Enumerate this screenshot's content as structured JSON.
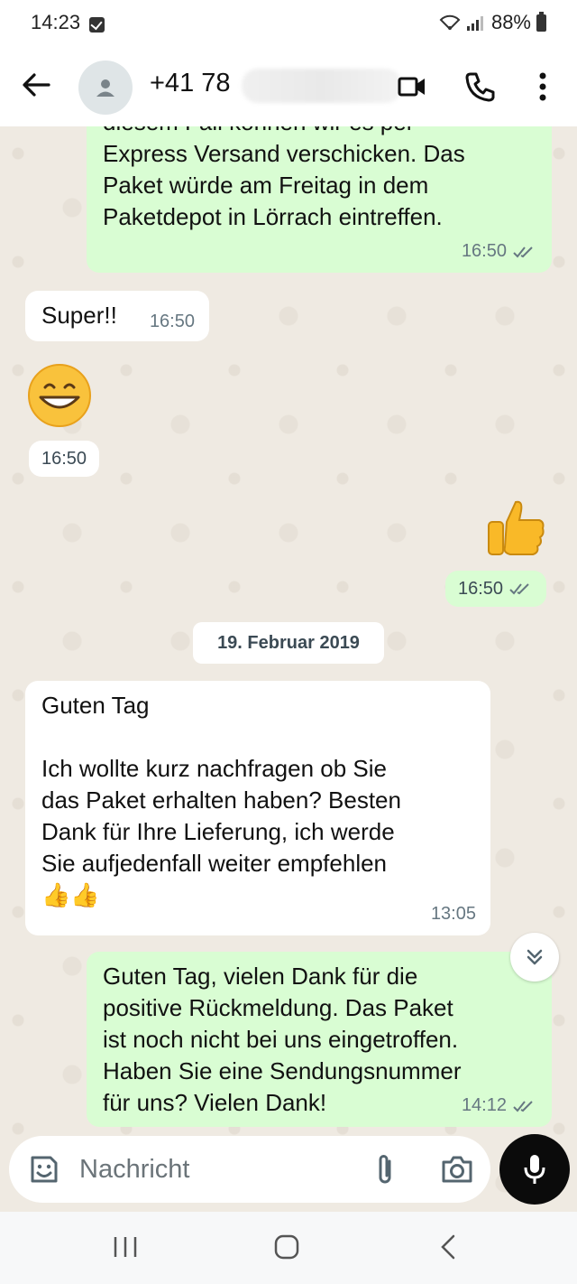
{
  "status_bar": {
    "time": "14:23",
    "battery": "88%"
  },
  "header": {
    "contact_name": "+41 78"
  },
  "messages": [
    {
      "direction": "out",
      "text_partial_top": "diesem Fall können wir es per",
      "text": "Express Versand verschicken. Das\nPaket würde am Freitag in dem\nPaketdepot in Lörrach eintreffen.",
      "time": "16:50"
    },
    {
      "direction": "in",
      "text": "Super!!",
      "time": "16:50"
    },
    {
      "direction": "in",
      "emoji": "😁",
      "time": "16:50"
    },
    {
      "direction": "out",
      "emoji": "👍",
      "time": "16:50"
    },
    {
      "direction": "in",
      "text": "Guten Tag\n\nIch wollte kurz nachfragen ob Sie\ndas Paket erhalten haben? Besten\nDank für Ihre Lieferung, ich werde\nSie aufjedenfall weiter empfehlen\n👍👍",
      "time": "13:05"
    },
    {
      "direction": "out",
      "text": "Guten Tag, vielen Dank für die\npositive Rückmeldung. Das Paket\nist noch nicht bei uns eingetroffen.\nHaben Sie eine Sendungsnummer\nfür uns? Vielen Dank!",
      "time": "14:12"
    }
  ],
  "date_divider": "19. Februar 2019",
  "input": {
    "placeholder": "Nachricht"
  },
  "colors": {
    "chat_bg": "#efeae2",
    "outgoing_bubble": "#d9fdd3",
    "incoming_bubble": "#ffffff",
    "read_tick": "#53bdeb",
    "mic_button": "#0b0b0b"
  },
  "icons": [
    "back-arrow-icon",
    "avatar-person-icon",
    "video-call-icon",
    "phone-call-icon",
    "more-vert-icon",
    "double-tick-icon",
    "sticker-icon",
    "attach-icon",
    "camera-icon",
    "mic-icon",
    "chevron-double-down-icon",
    "nav-recents-icon",
    "nav-home-icon",
    "nav-back-icon"
  ]
}
